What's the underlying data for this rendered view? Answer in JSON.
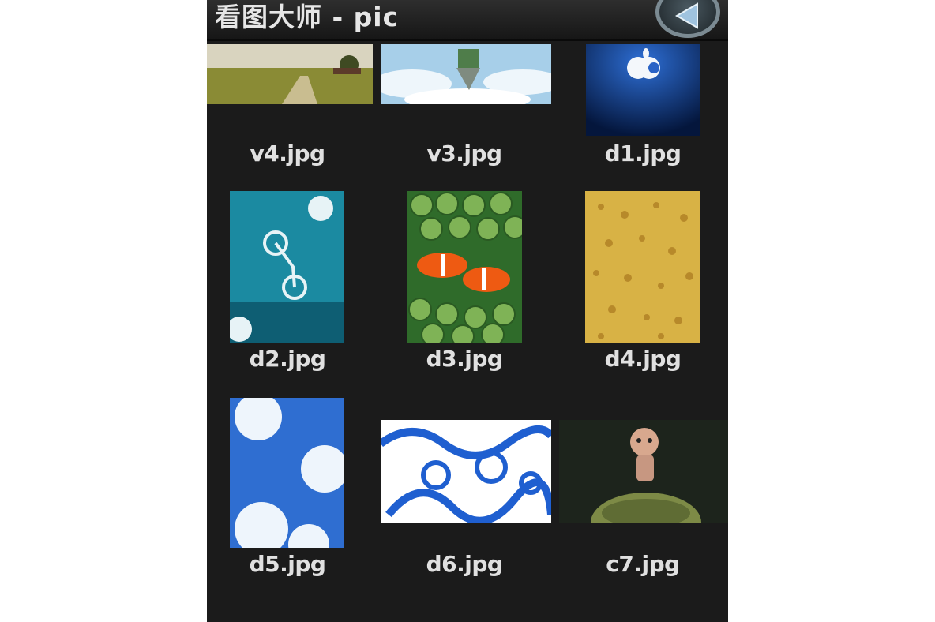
{
  "app": {
    "title": "看图大师 - pic",
    "back_icon": "back-arrow-icon"
  },
  "files": [
    {
      "name": "v4.jpg"
    },
    {
      "name": "v3.jpg"
    },
    {
      "name": "d1.jpg"
    },
    {
      "name": "d2.jpg"
    },
    {
      "name": "d3.jpg"
    },
    {
      "name": "d4.jpg"
    },
    {
      "name": "d5.jpg"
    },
    {
      "name": "d6.jpg"
    },
    {
      "name": "c7.jpg"
    }
  ]
}
